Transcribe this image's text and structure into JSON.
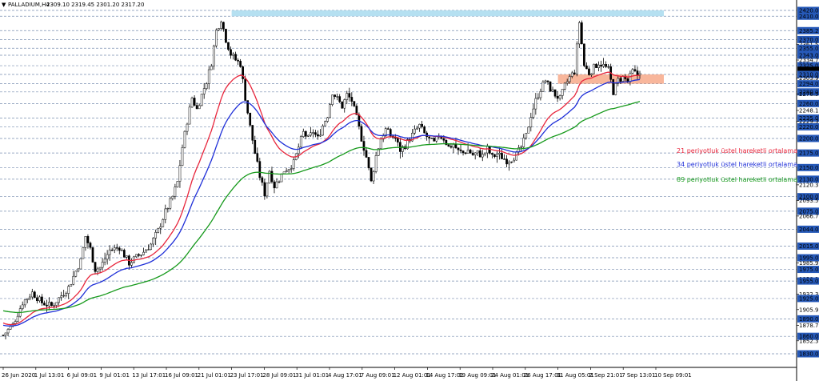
{
  "header": {
    "symbol_timeframe": "PALLADIUM,H4",
    "ohlc": "2309.10 2319.45 2301.20 2317.20"
  },
  "colors": {
    "background": "#ffffff",
    "grid": "#7a8fb0",
    "candle": "#000000",
    "ema21": "#e8263c",
    "ema34": "#1f2fd8",
    "ema89": "#179a1c",
    "resistance_zone": "#a8dbef",
    "support_zone": "#f7a98a",
    "level_label_bg": "#2659b8",
    "price_box": "#000000"
  },
  "chart_data": {
    "type": "candlestick",
    "symbol": "PALLADIUM",
    "timeframe": "H4",
    "last_price": 2317.2,
    "ylim": [
      1830,
      2420
    ],
    "y_axis_ticks": [
      2420.0,
      2410.0,
      2385.23,
      2370.0,
      2361.53,
      2355.0,
      2343.0,
      2334.72,
      2325.0,
      2317.2,
      2310.0,
      2303.92,
      2294.0,
      2280.0,
      2276.52,
      2260.0,
      2248.1,
      2235.0,
      2229.33,
      2220.0,
      2200.0,
      2175.0,
      2150.0,
      2130.0,
      2120.32,
      2100.0,
      2093.52,
      2075.0,
      2066.72,
      2044.0,
      2015.0,
      1995.0,
      1985.92,
      1975.0,
      1958.32,
      1955.0,
      1932.32,
      1925.0,
      1905.92,
      1890.0,
      1878.72,
      1860.0,
      1852.32,
      1830.0
    ],
    "x_axis_labels": [
      "26 Jun 2020",
      "1 Jul 13:01",
      "6 Jul 09:01",
      "9 Jul 01:01",
      "13 Jul 17:01",
      "16 Jul 09:01",
      "21 Jul 01:01",
      "23 Jul 17:01",
      "28 Jul 09:01",
      "31 Jul 01:01",
      "4 Aug 17:01",
      "7 Aug 09:01",
      "12 Aug 01:01",
      "14 Aug 17:01",
      "19 Aug 09:01",
      "24 Aug 01:01",
      "26 Aug 17:01",
      "31 Aug 05:01",
      "2 Sep 21:01",
      "7 Sep 13:01",
      "10 Sep 09:01"
    ],
    "grid": true,
    "zones": [
      {
        "name": "resistance",
        "from": "23 Jul 17:01",
        "to": "10 Sep 09:01",
        "low": 2410,
        "high": 2420
      },
      {
        "name": "support",
        "from": "31 Aug 05:01",
        "to": "10 Sep 09:01",
        "low": 2294,
        "high": 2310
      }
    ],
    "series": [
      {
        "name": "21 periyotluk üstel hareketli ortalama",
        "period": 21
      },
      {
        "name": "34 periyotluk üstel hareketli ortalama",
        "period": 34
      },
      {
        "name": "89 periyotluk üstel hareketli ortalama",
        "period": 89
      }
    ],
    "path_points": [
      [
        0,
        1862
      ],
      [
        4,
        1880
      ],
      [
        8,
        1918
      ],
      [
        12,
        1935
      ],
      [
        16,
        1918
      ],
      [
        20,
        1912
      ],
      [
        24,
        1930
      ],
      [
        27,
        1944
      ],
      [
        30,
        1972
      ],
      [
        32,
        1990
      ],
      [
        34,
        2032
      ],
      [
        36,
        2010
      ],
      [
        38,
        1975
      ],
      [
        40,
        1978
      ],
      [
        44,
        2008
      ],
      [
        48,
        2013
      ],
      [
        52,
        1986
      ],
      [
        55,
        1996
      ],
      [
        58,
        2005
      ],
      [
        61,
        2018
      ],
      [
        64,
        2042
      ],
      [
        67,
        2074
      ],
      [
        70,
        2100
      ],
      [
        72,
        2125
      ],
      [
        74,
        2185
      ],
      [
        76,
        2230
      ],
      [
        78,
        2270
      ],
      [
        80,
        2250
      ],
      [
        82,
        2275
      ],
      [
        84,
        2298
      ],
      [
        86,
        2330
      ],
      [
        88,
        2385
      ],
      [
        90,
        2405
      ],
      [
        92,
        2370
      ],
      [
        94,
        2345
      ],
      [
        96,
        2335
      ],
      [
        98,
        2328
      ],
      [
        100,
        2270
      ],
      [
        102,
        2220
      ],
      [
        104,
        2175
      ],
      [
        106,
        2135
      ],
      [
        108,
        2105
      ],
      [
        110,
        2145
      ],
      [
        112,
        2118
      ],
      [
        114,
        2130
      ],
      [
        116,
        2145
      ],
      [
        118,
        2150
      ],
      [
        120,
        2158
      ],
      [
        122,
        2185
      ],
      [
        124,
        2210
      ],
      [
        126,
        2200
      ],
      [
        128,
        2212
      ],
      [
        130,
        2200
      ],
      [
        132,
        2222
      ],
      [
        134,
        2240
      ],
      [
        136,
        2280
      ],
      [
        138,
        2268
      ],
      [
        140,
        2255
      ],
      [
        142,
        2275
      ],
      [
        144,
        2265
      ],
      [
        146,
        2235
      ],
      [
        148,
        2200
      ],
      [
        150,
        2168
      ],
      [
        152,
        2125
      ],
      [
        154,
        2170
      ],
      [
        156,
        2200
      ],
      [
        158,
        2215
      ],
      [
        160,
        2205
      ],
      [
        162,
        2200
      ],
      [
        164,
        2180
      ],
      [
        166,
        2188
      ],
      [
        168,
        2200
      ],
      [
        170,
        2212
      ],
      [
        172,
        2222
      ],
      [
        174,
        2208
      ],
      [
        176,
        2198
      ],
      [
        178,
        2192
      ],
      [
        180,
        2205
      ],
      [
        182,
        2200
      ],
      [
        184,
        2185
      ],
      [
        186,
        2190
      ],
      [
        188,
        2178
      ],
      [
        190,
        2175
      ],
      [
        192,
        2180
      ],
      [
        194,
        2172
      ],
      [
        196,
        2175
      ],
      [
        198,
        2170
      ],
      [
        200,
        2182
      ],
      [
        202,
        2168
      ],
      [
        204,
        2173
      ],
      [
        206,
        2168
      ],
      [
        208,
        2162
      ],
      [
        210,
        2165
      ],
      [
        212,
        2172
      ],
      [
        214,
        2185
      ],
      [
        216,
        2205
      ],
      [
        218,
        2240
      ],
      [
        220,
        2265
      ],
      [
        222,
        2285
      ],
      [
        224,
        2300
      ],
      [
        226,
        2285
      ],
      [
        228,
        2275
      ],
      [
        230,
        2268
      ],
      [
        232,
        2290
      ],
      [
        234,
        2305
      ],
      [
        236,
        2315
      ],
      [
        238,
        2400
      ],
      [
        240,
        2325
      ],
      [
        242,
        2312
      ],
      [
        244,
        2322
      ],
      [
        246,
        2330
      ],
      [
        248,
        2325
      ],
      [
        250,
        2318
      ],
      [
        252,
        2280
      ],
      [
        254,
        2300
      ],
      [
        256,
        2305
      ],
      [
        258,
        2298
      ],
      [
        260,
        2315
      ],
      [
        262,
        2310
      ],
      [
        263,
        2317.2
      ]
    ],
    "annotations": [
      "21 periyotluk üstel hareketli ortalama",
      "34 periyotluk üstel hareketli ortalama",
      "89 periyotluk üstel hareketli ortalama"
    ]
  }
}
